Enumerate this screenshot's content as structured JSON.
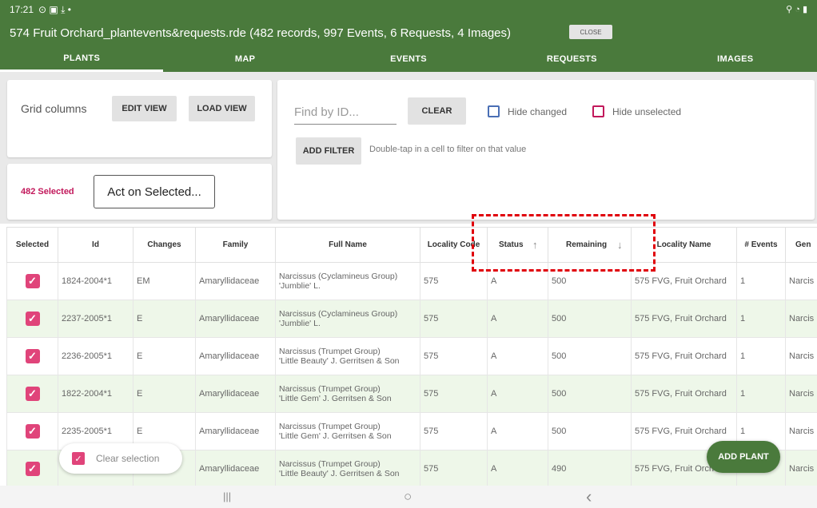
{
  "status_bar": {
    "time": "17:21",
    "left_icons": "⊙ ▣ ⤓ •",
    "right_icons": "⚲ ◔ ▮"
  },
  "title": "574 Fruit Orchard_plantevents&requests.rde (482 records, 997 Events, 6 Requests, 4 Images)",
  "close_label": "CLOSE",
  "tabs": [
    "PLANTS",
    "MAP",
    "EVENTS",
    "REQUESTS",
    "IMAGES"
  ],
  "grid_columns": {
    "label": "Grid columns",
    "edit_view": "EDIT VIEW",
    "load_view": "LOAD VIEW"
  },
  "selection": {
    "count_label": "482 Selected",
    "act_button": "Act on Selected..."
  },
  "filter": {
    "find_placeholder": "Find by ID...",
    "clear": "CLEAR",
    "hide_changed": "Hide changed",
    "hide_unselected": "Hide unselected",
    "add_filter": "ADD FILTER",
    "hint": "Double-tap in a cell to filter on that value"
  },
  "colors": {
    "primary_green": "#4a7a3c",
    "accent_pink": "#e0447a",
    "row_green": "#eef7e9",
    "highlight_red": "#e0000a",
    "hide_changed_border": "#4a6fb5",
    "hide_unselected_border": "#c2185b"
  },
  "table": {
    "columns": [
      "Selected",
      "Id",
      "Changes",
      "Family",
      "Full Name",
      "Locality Code",
      "Status",
      "Remaining",
      "Locality Name",
      "# Events",
      "Gen"
    ],
    "sorting": {
      "Status": "ascending",
      "Remaining": "descending"
    },
    "rows": [
      {
        "selected": true,
        "id": "1824-2004*1",
        "changes": "EM",
        "family": "Amaryllidaceae",
        "full_name_1": "Narcissus (Cyclamineus Group)",
        "full_name_2": "'Jumblie' L.",
        "locality_code": "575",
        "status": "A",
        "remaining": "500",
        "locality_name": "575 FVG, Fruit Orchard",
        "events": "1",
        "gen": "Narcis"
      },
      {
        "selected": true,
        "id": "2237-2005*1",
        "changes": "E",
        "family": "Amaryllidaceae",
        "full_name_1": "Narcissus (Cyclamineus Group)",
        "full_name_2": "'Jumblie' L.",
        "locality_code": "575",
        "status": "A",
        "remaining": "500",
        "locality_name": "575 FVG, Fruit Orchard",
        "events": "1",
        "gen": "Narcis"
      },
      {
        "selected": true,
        "id": "2236-2005*1",
        "changes": "E",
        "family": "Amaryllidaceae",
        "full_name_1": "Narcissus (Trumpet Group)",
        "full_name_2": "'Little Beauty' J. Gerritsen & Son",
        "locality_code": "575",
        "status": "A",
        "remaining": "500",
        "locality_name": "575 FVG, Fruit Orchard",
        "events": "1",
        "gen": "Narcis"
      },
      {
        "selected": true,
        "id": "1822-2004*1",
        "changes": "E",
        "family": "Amaryllidaceae",
        "full_name_1": "Narcissus (Trumpet Group)",
        "full_name_2": "'Little Gem' J. Gerritsen & Son",
        "locality_code": "575",
        "status": "A",
        "remaining": "500",
        "locality_name": "575 FVG, Fruit Orchard",
        "events": "1",
        "gen": "Narcis"
      },
      {
        "selected": true,
        "id": "2235-2005*1",
        "changes": "E",
        "family": "Amaryllidaceae",
        "full_name_1": "Narcissus (Trumpet Group)",
        "full_name_2": "'Little Gem' J. Gerritsen & Son",
        "locality_code": "575",
        "status": "A",
        "remaining": "500",
        "locality_name": "575 FVG, Fruit Orchard",
        "events": "1",
        "gen": "Narcis"
      },
      {
        "selected": true,
        "id": "",
        "changes": "",
        "family": "Amaryllidaceae",
        "full_name_1": "Narcissus (Trumpet Group)",
        "full_name_2": "'Little Beauty' J. Gerritsen & Son",
        "locality_code": "575",
        "status": "A",
        "remaining": "490",
        "locality_name": "575 FVG, Fruit Orch",
        "events": "",
        "gen": "Narcis"
      }
    ]
  },
  "clear_selection": "Clear selection",
  "add_plant": "ADD PLANT",
  "nav": {
    "recents": "|||",
    "home": "○",
    "back": "‹"
  }
}
